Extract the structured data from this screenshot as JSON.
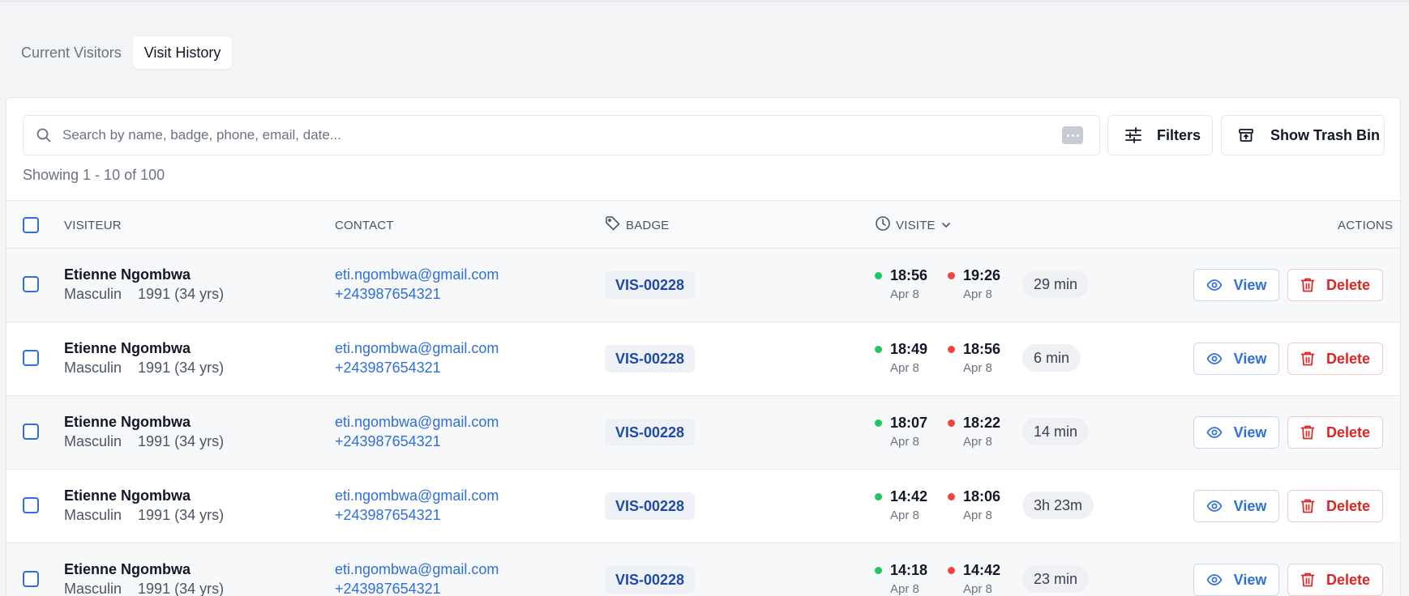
{
  "tabs": [
    {
      "label": "Current Visitors",
      "active": false
    },
    {
      "label": "Visit History",
      "active": true
    }
  ],
  "search": {
    "placeholder": "Search by name, badge, phone, email, date...",
    "value": ""
  },
  "toolbar": {
    "filters_label": "Filters",
    "trash_label": "Show Trash Bin"
  },
  "showing": "Showing 1 - 10 of 100",
  "columns": {
    "visitor": "VISITEUR",
    "contact": "CONTACT",
    "badge": "BADGE",
    "visit": "VISITE",
    "actions": "ACTIONS"
  },
  "actions": {
    "view": "View",
    "delete": "Delete"
  },
  "colors": {
    "accent": "#2f6fdc",
    "danger": "#dc2626",
    "check_in": "#22c55e",
    "check_out": "#ef4444"
  },
  "rows": [
    {
      "name": "Etienne Ngombwa",
      "gender": "Masculin",
      "birth": "1991 (34 yrs)",
      "email": "eti.ngombwa@gmail.com",
      "phone": "+243987654321",
      "badge": "VIS-00228",
      "in_time": "18:56",
      "in_date": "Apr 8",
      "out_time": "19:26",
      "out_date": "Apr 8",
      "duration": "29 min"
    },
    {
      "name": "Etienne Ngombwa",
      "gender": "Masculin",
      "birth": "1991 (34 yrs)",
      "email": "eti.ngombwa@gmail.com",
      "phone": "+243987654321",
      "badge": "VIS-00228",
      "in_time": "18:49",
      "in_date": "Apr 8",
      "out_time": "18:56",
      "out_date": "Apr 8",
      "duration": "6 min"
    },
    {
      "name": "Etienne Ngombwa",
      "gender": "Masculin",
      "birth": "1991 (34 yrs)",
      "email": "eti.ngombwa@gmail.com",
      "phone": "+243987654321",
      "badge": "VIS-00228",
      "in_time": "18:07",
      "in_date": "Apr 8",
      "out_time": "18:22",
      "out_date": "Apr 8",
      "duration": "14 min"
    },
    {
      "name": "Etienne Ngombwa",
      "gender": "Masculin",
      "birth": "1991 (34 yrs)",
      "email": "eti.ngombwa@gmail.com",
      "phone": "+243987654321",
      "badge": "VIS-00228",
      "in_time": "14:42",
      "in_date": "Apr 8",
      "out_time": "18:06",
      "out_date": "Apr 8",
      "duration": "3h 23m"
    },
    {
      "name": "Etienne Ngombwa",
      "gender": "Masculin",
      "birth": "1991 (34 yrs)",
      "email": "eti.ngombwa@gmail.com",
      "phone": "+243987654321",
      "badge": "VIS-00228",
      "in_time": "14:18",
      "in_date": "Apr 8",
      "out_time": "14:42",
      "out_date": "Apr 8",
      "duration": "23 min"
    }
  ]
}
